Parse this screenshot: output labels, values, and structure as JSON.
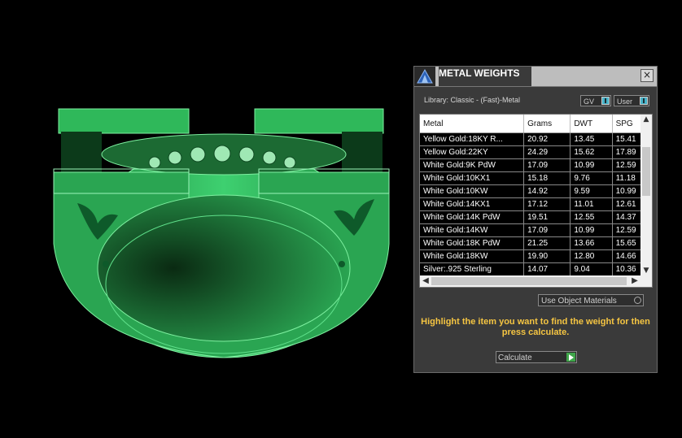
{
  "colors": {
    "model_green": "#2fbf5f",
    "hint_yellow": "#f5c542",
    "panel_bg": "#3a3a3a",
    "toggle_indicator": "#47b3c9"
  },
  "panel": {
    "title": "METAL WEIGHTS",
    "close_icon": "close-icon",
    "library": "Library: Classic - (Fast)-Metal",
    "toggles": [
      {
        "label": "GV"
      },
      {
        "label": "User"
      }
    ],
    "table": {
      "headers": [
        "Metal",
        "Grams",
        "DWT",
        "SPG"
      ],
      "rows": [
        [
          "Yellow Gold:18KY R...",
          "20.92",
          "13.45",
          "15.41"
        ],
        [
          "Yellow Gold:22KY",
          "24.29",
          "15.62",
          "17.89"
        ],
        [
          "White Gold:9K PdW",
          "17.09",
          "10.99",
          "12.59"
        ],
        [
          "White Gold:10KX1",
          "15.18",
          "9.76",
          "11.18"
        ],
        [
          "White Gold:10KW",
          "14.92",
          "9.59",
          "10.99"
        ],
        [
          "White Gold:14KX1",
          "17.12",
          "11.01",
          "12.61"
        ],
        [
          "White Gold:14K PdW",
          "19.51",
          "12.55",
          "14.37"
        ],
        [
          "White Gold:14KW",
          "17.09",
          "10.99",
          "12.59"
        ],
        [
          "White Gold:18K PdW",
          "21.25",
          "13.66",
          "15.65"
        ],
        [
          "White Gold:18KW",
          "19.90",
          "12.80",
          "14.66"
        ],
        [
          "Silver:.925 Sterling",
          "14.07",
          "9.04",
          "10.36"
        ]
      ]
    },
    "use_object_materials": "Use Object Materials",
    "hint": "Highlight the item you want to find the weight for then press calculate.",
    "calculate": "Calculate"
  }
}
